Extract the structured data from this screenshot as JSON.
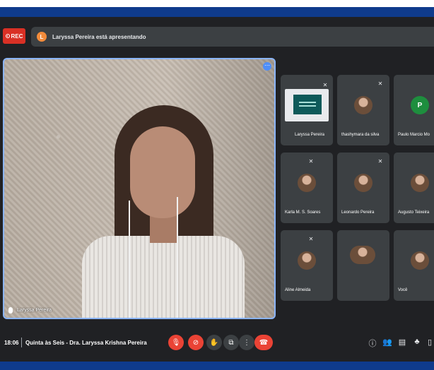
{
  "recording": {
    "label": "REC"
  },
  "presenting_banner": {
    "avatar_letter": "L",
    "text": "Laryssa Pereira está apresentando"
  },
  "main_video": {
    "name": "Laryssa Pereira"
  },
  "participants": [
    {
      "name": "Laryssa Pereira",
      "type": "screen"
    },
    {
      "name": "thashymara da silva",
      "type": "photo"
    },
    {
      "name": "Paulo Marcio Mo",
      "type": "letter",
      "letter": "P",
      "color": "#1e8e3e"
    },
    {
      "name": "Karla M. S. Soares",
      "type": "photo"
    },
    {
      "name": "Leonardo Pereira",
      "type": "photo"
    },
    {
      "name": "Augusto Teixeira",
      "type": "photo"
    },
    {
      "name": "Aline Almeida",
      "type": "photo"
    },
    {
      "name": "",
      "type": "photo"
    },
    {
      "name": "Você",
      "type": "photo"
    }
  ],
  "meeting": {
    "time": "18:06",
    "title": "Quinta às Seis - Dra. Laryssa Krishna Pereira"
  },
  "colors": {
    "accent": "#8ab4f8",
    "danger": "#ea4335",
    "background": "#202124",
    "tile": "#3c4043"
  }
}
